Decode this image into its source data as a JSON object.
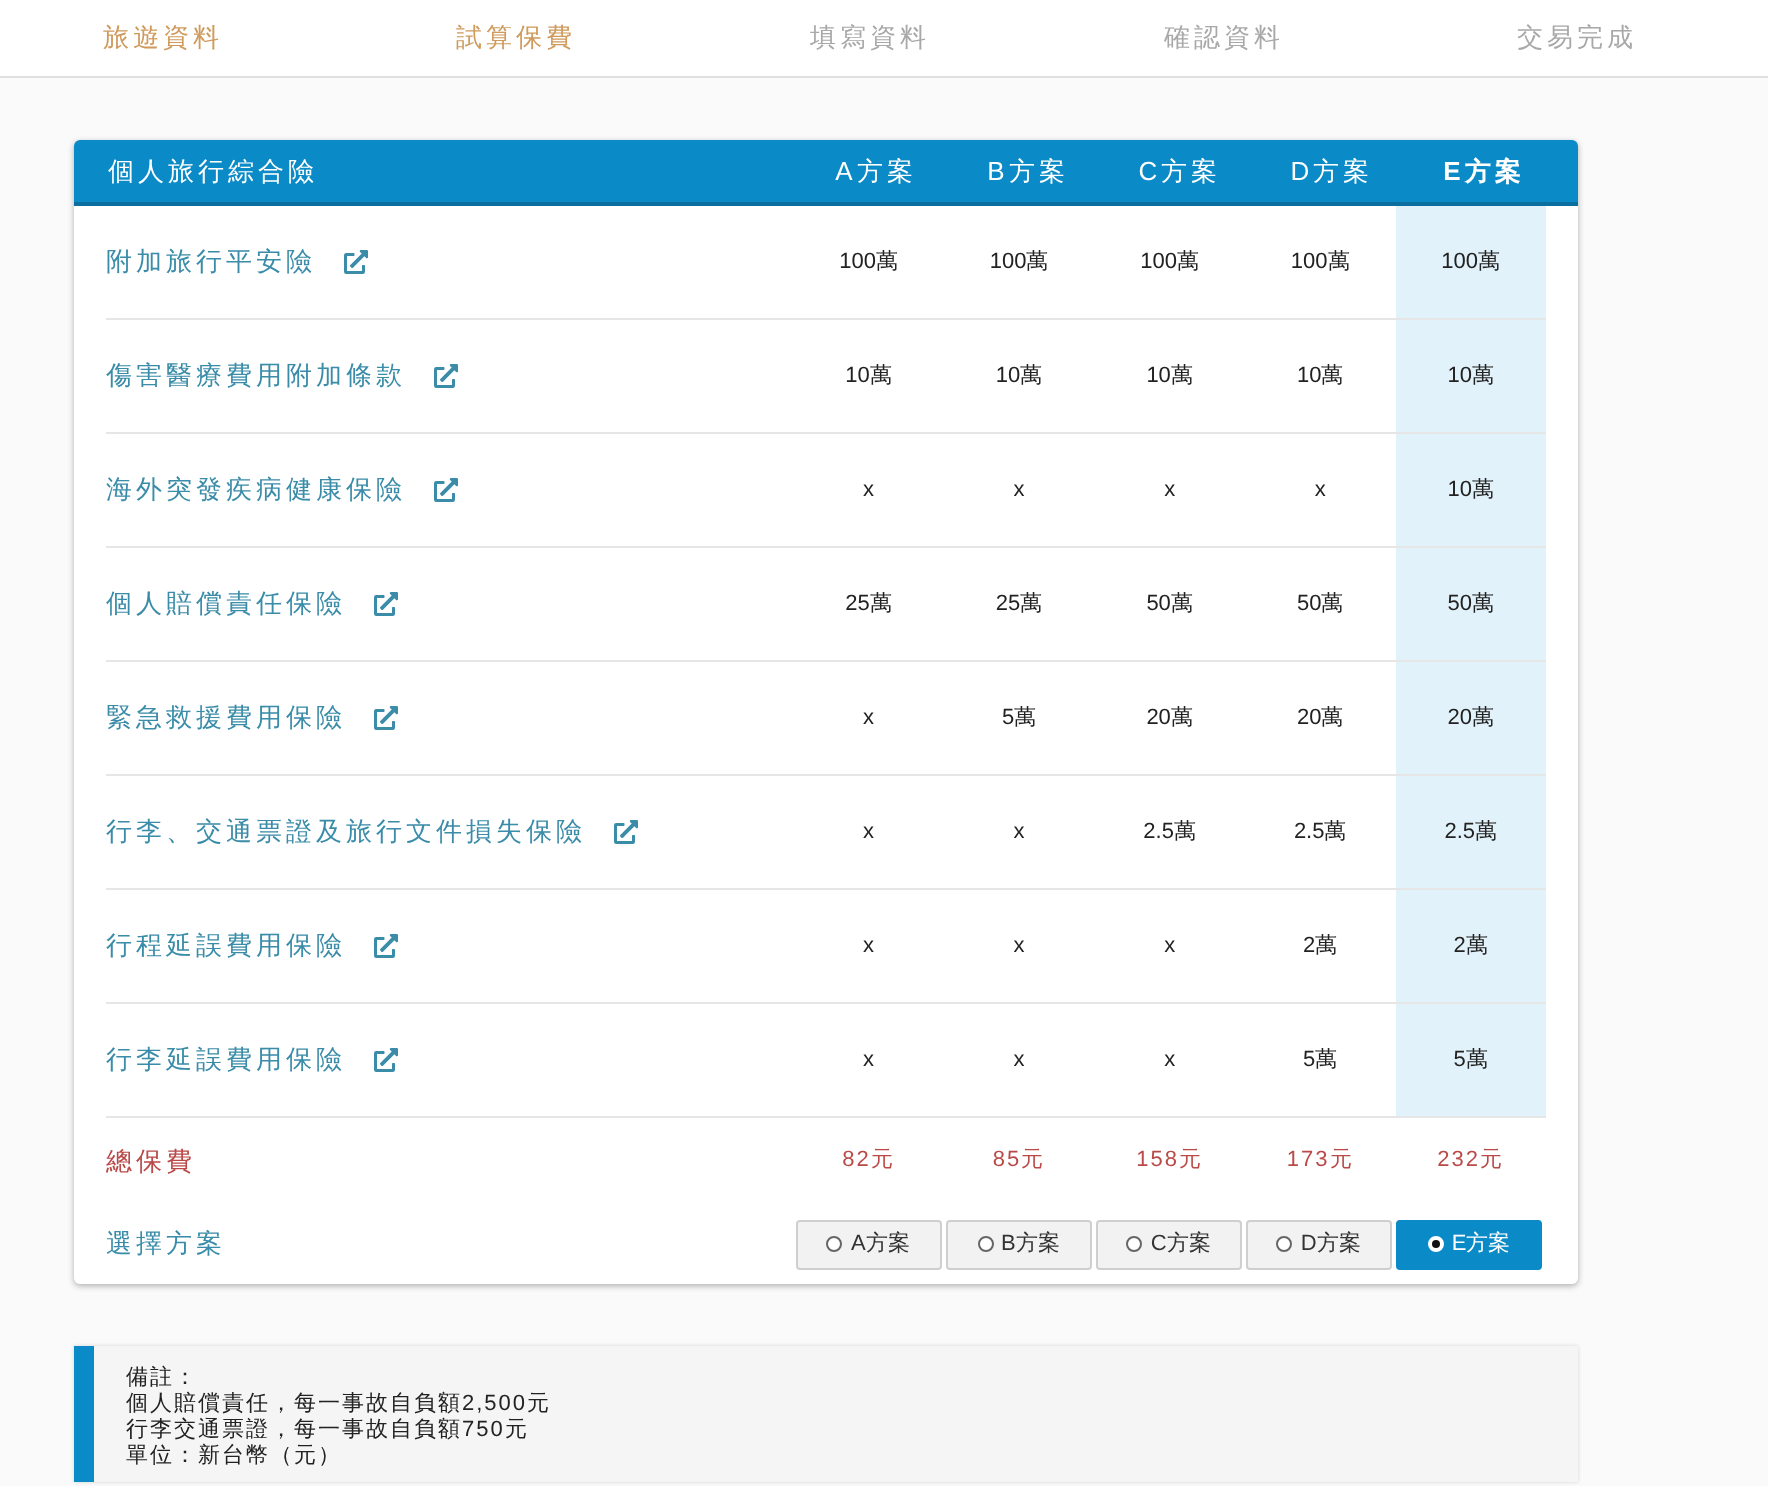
{
  "steps": [
    {
      "label": "旅遊資料",
      "active": true
    },
    {
      "label": "試算保費",
      "active": true
    },
    {
      "label": "填寫資料",
      "active": false
    },
    {
      "label": "確認資料",
      "active": false
    },
    {
      "label": "交易完成",
      "active": false
    }
  ],
  "table": {
    "title": "個人旅行綜合險",
    "plans": [
      {
        "label": "A方案",
        "selected": false
      },
      {
        "label": "B方案",
        "selected": false
      },
      {
        "label": "C方案",
        "selected": false
      },
      {
        "label": "D方案",
        "selected": false
      },
      {
        "label": "E方案",
        "selected": true
      }
    ],
    "rows": [
      {
        "name": "附加旅行平安險",
        "values": [
          "100萬",
          "100萬",
          "100萬",
          "100萬",
          "100萬"
        ]
      },
      {
        "name": "傷害醫療費用附加條款",
        "values": [
          "10萬",
          "10萬",
          "10萬",
          "10萬",
          "10萬"
        ]
      },
      {
        "name": "海外突發疾病健康保險",
        "values": [
          "x",
          "x",
          "x",
          "x",
          "10萬"
        ]
      },
      {
        "name": "個人賠償責任保險",
        "values": [
          "25萬",
          "25萬",
          "50萬",
          "50萬",
          "50萬"
        ]
      },
      {
        "name": "緊急救援費用保險",
        "values": [
          "x",
          "5萬",
          "20萬",
          "20萬",
          "20萬"
        ]
      },
      {
        "name": "行李、交通票證及旅行文件損失保險",
        "values": [
          "x",
          "x",
          "2.5萬",
          "2.5萬",
          "2.5萬"
        ]
      },
      {
        "name": "行程延誤費用保險",
        "values": [
          "x",
          "x",
          "x",
          "2萬",
          "2萬"
        ]
      },
      {
        "name": "行李延誤費用保險",
        "values": [
          "x",
          "x",
          "x",
          "5萬",
          "5萬"
        ]
      }
    ],
    "total": {
      "label": "總保費",
      "values": [
        "82元",
        "85元",
        "158元",
        "173元",
        "232元"
      ]
    },
    "choose": {
      "label": "選擇方案",
      "options": [
        "A方案",
        "B方案",
        "C方案",
        "D方案",
        "E方案"
      ]
    }
  },
  "notes": [
    "備註：",
    "個人賠償責任，每一事故自負額2,500元",
    "行李交通票證，每一事故自負額750元",
    "單位：新台幣（元）"
  ]
}
